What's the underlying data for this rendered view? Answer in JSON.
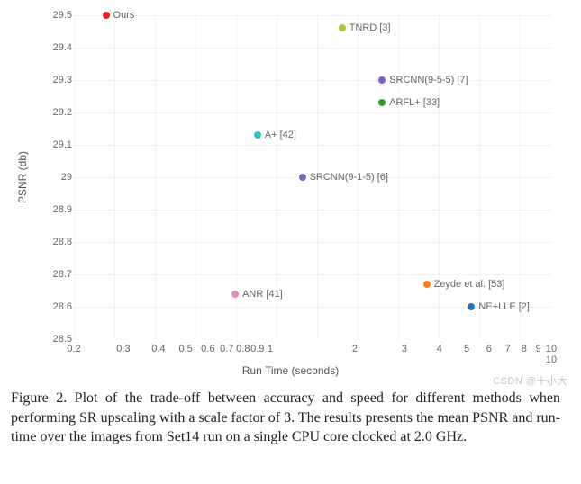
{
  "chart_data": {
    "type": "scatter",
    "xlabel": "Run Time (seconds)",
    "ylabel": "PSNR (db)",
    "x_scale": "log",
    "xlim": [
      0.2,
      10
    ],
    "ylim": [
      28.5,
      29.5
    ],
    "x_ticks": [
      0.2,
      0.3,
      0.4,
      0.5,
      0.6,
      0.7,
      0.8,
      0.9,
      1,
      2,
      3,
      4,
      5,
      6,
      7,
      8,
      9,
      10
    ],
    "y_ticks": [
      28.5,
      28.6,
      28.7,
      28.8,
      28.9,
      29.0,
      29.1,
      29.2,
      29.3,
      29.4,
      29.5
    ],
    "x_tick_labels": [
      "0.2",
      "0.3",
      "0.4",
      "0.5",
      "0.6",
      "0.7",
      "0.8",
      "0.9",
      "1",
      "2",
      "3",
      "4",
      "5",
      "6",
      "7",
      "8",
      "9",
      "10"
    ],
    "y_tick_labels": [
      "28.5",
      "28.6",
      "28.7",
      "28.8",
      "28.9",
      "29",
      "29.1",
      "29.2",
      "29.3",
      "29.4",
      "29.5"
    ],
    "points": [
      {
        "label": "Ours",
        "x": 0.26,
        "y": 29.5,
        "color": "#e81e20"
      },
      {
        "label": "TNRD [3]",
        "x": 1.8,
        "y": 29.46,
        "color": "#b7c23c"
      },
      {
        "label": "SRCNN(9-5-5) [7]",
        "x": 2.5,
        "y": 29.3,
        "color": "#8060c8"
      },
      {
        "label": "ARFL+ [33]",
        "x": 2.5,
        "y": 29.23,
        "color": "#2ca02c"
      },
      {
        "label": "A+ [42]",
        "x": 0.9,
        "y": 29.13,
        "color": "#2ec4c4"
      },
      {
        "label": "SRCNN(9-1-5) [6]",
        "x": 1.3,
        "y": 29.0,
        "color": "#8060c8"
      },
      {
        "label": "Zeyde et al. [53]",
        "x": 3.6,
        "y": 28.67,
        "color": "#ff7f0e"
      },
      {
        "label": "ANR [41]",
        "x": 0.75,
        "y": 28.64,
        "color": "#e38ec2"
      },
      {
        "label": "NE+LLE [2]",
        "x": 5.2,
        "y": 28.6,
        "color": "#1f77b4"
      }
    ]
  },
  "caption": "Figure 2. Plot of the trade-off between accuracy and speed for different methods when performing SR upscaling with a scale factor of 3.  The results presents the mean PSNR and run-time over the images from Set14 run on a single CPU core clocked at 2.0 GHz.",
  "watermark": "CSDN @十小大"
}
